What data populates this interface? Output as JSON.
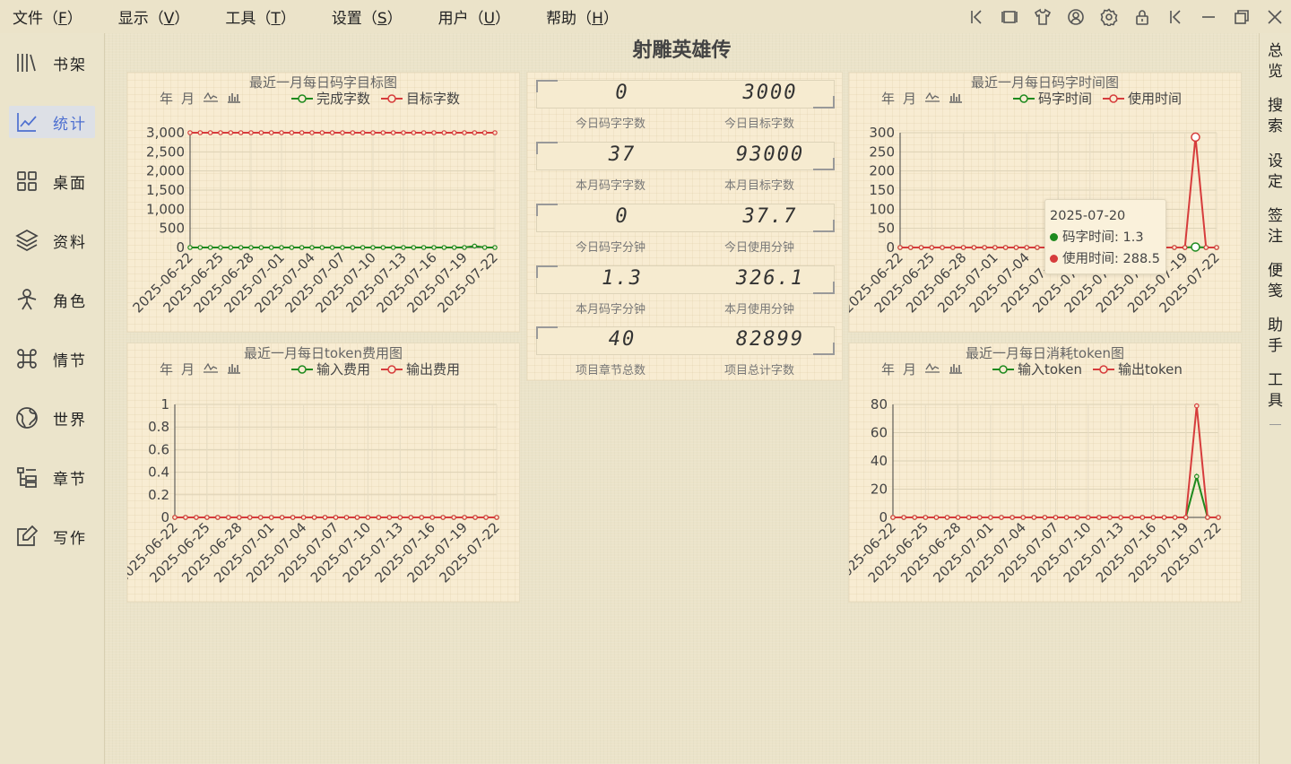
{
  "menu": [
    {
      "label": "文件",
      "key": "F"
    },
    {
      "label": "显示",
      "key": "V"
    },
    {
      "label": "工具",
      "key": "T"
    },
    {
      "label": "设置",
      "key": "S"
    },
    {
      "label": "用户",
      "key": "U"
    },
    {
      "label": "帮助",
      "key": "H"
    }
  ],
  "toolbar_icons": [
    "collapse-left-icon",
    "window-frame-icon",
    "shirt-theme-icon",
    "user-circle-icon",
    "gear-icon",
    "lock-icon",
    "chevron-left-icon",
    "minimize-icon",
    "restore-icon",
    "close-icon"
  ],
  "sidebar": {
    "items": [
      {
        "label": "书架",
        "icon": "bookshelf-icon"
      },
      {
        "label": "统计",
        "icon": "chart-line-icon",
        "active": true
      },
      {
        "label": "桌面",
        "icon": "grid-icon"
      },
      {
        "label": "资料",
        "icon": "layers-icon"
      },
      {
        "label": "角色",
        "icon": "person-icon"
      },
      {
        "label": "情节",
        "icon": "command-icon"
      },
      {
        "label": "世界",
        "icon": "globe-icon"
      },
      {
        "label": "章节",
        "icon": "tree-list-icon"
      },
      {
        "label": "写作",
        "icon": "edit-icon"
      }
    ]
  },
  "rightbar": {
    "items": [
      {
        "top": "总",
        "bottom": "览"
      },
      {
        "top": "搜",
        "bottom": "索"
      },
      {
        "top": "设",
        "bottom": "定"
      },
      {
        "top": "签",
        "bottom": "注"
      },
      {
        "top": "便",
        "bottom": "笺"
      },
      {
        "top": "助",
        "bottom": "手"
      },
      {
        "top": "工",
        "bottom": "具"
      }
    ]
  },
  "project_title": "射雕英雄传",
  "chart_toolbar": {
    "year": "年",
    "month": "月",
    "line": "line-chart-icon",
    "bar": "bar-chart-icon"
  },
  "stats": [
    {
      "left_value": "0",
      "left_label": "今日码字字数",
      "right_value": "3000",
      "right_label": "今日目标字数"
    },
    {
      "left_value": "37",
      "left_label": "本月码字字数",
      "right_value": "93000",
      "right_label": "本月目标字数"
    },
    {
      "left_value": "0",
      "left_label": "今日码字分钟",
      "right_value": "37.7",
      "right_label": "今日使用分钟"
    },
    {
      "left_value": "1.3",
      "left_label": "本月码字分钟",
      "right_value": "326.1",
      "right_label": "本月使用分钟"
    },
    {
      "left_value": "40",
      "left_label": "项目章节总数",
      "right_value": "82899",
      "right_label": "项目总计字数"
    }
  ],
  "tooltip": {
    "date": "2025-07-20",
    "row1": "码字时间: 1.3",
    "row2": "使用时间: 288.5"
  },
  "chart_data": [
    {
      "type": "line",
      "title": "最近一月每日码字目标图",
      "x": [
        "2025-06-22",
        "2025-06-23",
        "2025-06-24",
        "2025-06-25",
        "2025-06-26",
        "2025-06-27",
        "2025-06-28",
        "2025-06-29",
        "2025-06-30",
        "2025-07-01",
        "2025-07-02",
        "2025-07-03",
        "2025-07-04",
        "2025-07-05",
        "2025-07-06",
        "2025-07-07",
        "2025-07-08",
        "2025-07-09",
        "2025-07-10",
        "2025-07-11",
        "2025-07-12",
        "2025-07-13",
        "2025-07-14",
        "2025-07-15",
        "2025-07-16",
        "2025-07-17",
        "2025-07-18",
        "2025-07-19",
        "2025-07-20",
        "2025-07-21",
        "2025-07-22"
      ],
      "xticks": [
        "2025-06-22",
        "2025-06-25",
        "2025-06-28",
        "2025-07-01",
        "2025-07-04",
        "2025-07-07",
        "2025-07-10",
        "2025-07-13",
        "2025-07-16",
        "2025-07-19",
        "2025-07-22"
      ],
      "yticks": [
        "0",
        "500",
        "1,000",
        "1,500",
        "2,000",
        "2,500",
        "3,000"
      ],
      "ylim": [
        0,
        3000
      ],
      "series": [
        {
          "name": "完成字数",
          "color": "#1e8a1e",
          "values": [
            0,
            0,
            0,
            0,
            0,
            0,
            0,
            0,
            0,
            0,
            0,
            0,
            0,
            0,
            0,
            0,
            0,
            0,
            0,
            0,
            0,
            0,
            0,
            0,
            0,
            0,
            0,
            0,
            37,
            0,
            0
          ]
        },
        {
          "name": "目标字数",
          "color": "#d63c3c",
          "values": [
            3000,
            3000,
            3000,
            3000,
            3000,
            3000,
            3000,
            3000,
            3000,
            3000,
            3000,
            3000,
            3000,
            3000,
            3000,
            3000,
            3000,
            3000,
            3000,
            3000,
            3000,
            3000,
            3000,
            3000,
            3000,
            3000,
            3000,
            3000,
            3000,
            3000,
            3000
          ]
        }
      ]
    },
    {
      "type": "line",
      "title": "最近一月每日码字时间图",
      "x": [
        "2025-06-22",
        "2025-06-23",
        "2025-06-24",
        "2025-06-25",
        "2025-06-26",
        "2025-06-27",
        "2025-06-28",
        "2025-06-29",
        "2025-06-30",
        "2025-07-01",
        "2025-07-02",
        "2025-07-03",
        "2025-07-04",
        "2025-07-05",
        "2025-07-06",
        "2025-07-07",
        "2025-07-08",
        "2025-07-09",
        "2025-07-10",
        "2025-07-11",
        "2025-07-12",
        "2025-07-13",
        "2025-07-14",
        "2025-07-15",
        "2025-07-16",
        "2025-07-17",
        "2025-07-18",
        "2025-07-19",
        "2025-07-20",
        "2025-07-21",
        "2025-07-22"
      ],
      "xticks": [
        "2025-06-22",
        "2025-06-25",
        "2025-06-28",
        "2025-07-01",
        "2025-07-04",
        "2025-07-07",
        "2025-07-10",
        "2025-07-13",
        "2025-07-16",
        "2025-07-19",
        "2025-07-22"
      ],
      "yticks": [
        "0",
        "50",
        "100",
        "150",
        "200",
        "250",
        "300"
      ],
      "ylim": [
        0,
        300
      ],
      "series": [
        {
          "name": "码字时间",
          "color": "#1e8a1e",
          "values": [
            0,
            0,
            0,
            0,
            0,
            0,
            0,
            0,
            0,
            0,
            0,
            0,
            0,
            0,
            0,
            0,
            0,
            0,
            0,
            0,
            0,
            0,
            0,
            0,
            0,
            0,
            0,
            0,
            1.3,
            0,
            0
          ]
        },
        {
          "name": "使用时间",
          "color": "#d63c3c",
          "values": [
            0,
            0,
            0,
            0,
            0,
            0,
            0,
            0,
            0,
            0,
            0,
            0,
            0,
            0,
            0,
            0,
            0,
            0,
            0,
            0,
            0,
            0,
            0,
            0,
            0,
            0,
            0,
            0,
            288.5,
            0,
            0
          ]
        }
      ]
    },
    {
      "type": "line",
      "title": "最近一月每日token费用图",
      "x": [
        "2025-06-22",
        "2025-06-23",
        "2025-06-24",
        "2025-06-25",
        "2025-06-26",
        "2025-06-27",
        "2025-06-28",
        "2025-06-29",
        "2025-06-30",
        "2025-07-01",
        "2025-07-02",
        "2025-07-03",
        "2025-07-04",
        "2025-07-05",
        "2025-07-06",
        "2025-07-07",
        "2025-07-08",
        "2025-07-09",
        "2025-07-10",
        "2025-07-11",
        "2025-07-12",
        "2025-07-13",
        "2025-07-14",
        "2025-07-15",
        "2025-07-16",
        "2025-07-17",
        "2025-07-18",
        "2025-07-19",
        "2025-07-20",
        "2025-07-21",
        "2025-07-22"
      ],
      "xticks": [
        "2025-06-22",
        "2025-06-25",
        "2025-06-28",
        "2025-07-01",
        "2025-07-04",
        "2025-07-07",
        "2025-07-10",
        "2025-07-13",
        "2025-07-16",
        "2025-07-19",
        "2025-07-22"
      ],
      "yticks": [
        "0",
        "0.2",
        "0.4",
        "0.6",
        "0.8",
        "1"
      ],
      "ylim": [
        0,
        1
      ],
      "series": [
        {
          "name": "输入费用",
          "color": "#1e8a1e",
          "values": [
            0,
            0,
            0,
            0,
            0,
            0,
            0,
            0,
            0,
            0,
            0,
            0,
            0,
            0,
            0,
            0,
            0,
            0,
            0,
            0,
            0,
            0,
            0,
            0,
            0,
            0,
            0,
            0,
            0,
            0,
            0
          ]
        },
        {
          "name": "输出费用",
          "color": "#d63c3c",
          "values": [
            0,
            0,
            0,
            0,
            0,
            0,
            0,
            0,
            0,
            0,
            0,
            0,
            0,
            0,
            0,
            0,
            0,
            0,
            0,
            0,
            0,
            0,
            0,
            0,
            0,
            0,
            0,
            0,
            0,
            0,
            0
          ]
        }
      ]
    },
    {
      "type": "line",
      "title": "最近一月每日消耗token图",
      "x": [
        "2025-06-22",
        "2025-06-23",
        "2025-06-24",
        "2025-06-25",
        "2025-06-26",
        "2025-06-27",
        "2025-06-28",
        "2025-06-29",
        "2025-06-30",
        "2025-07-01",
        "2025-07-02",
        "2025-07-03",
        "2025-07-04",
        "2025-07-05",
        "2025-07-06",
        "2025-07-07",
        "2025-07-08",
        "2025-07-09",
        "2025-07-10",
        "2025-07-11",
        "2025-07-12",
        "2025-07-13",
        "2025-07-14",
        "2025-07-15",
        "2025-07-16",
        "2025-07-17",
        "2025-07-18",
        "2025-07-19",
        "2025-07-20",
        "2025-07-21",
        "2025-07-22"
      ],
      "xticks": [
        "2025-06-22",
        "2025-06-25",
        "2025-06-28",
        "2025-07-01",
        "2025-07-04",
        "2025-07-07",
        "2025-07-10",
        "2025-07-13",
        "2025-07-16",
        "2025-07-19",
        "2025-07-22"
      ],
      "yticks": [
        "0",
        "20",
        "40",
        "60",
        "80"
      ],
      "ylim": [
        0,
        80
      ],
      "series": [
        {
          "name": "输入token",
          "color": "#1e8a1e",
          "values": [
            0,
            0,
            0,
            0,
            0,
            0,
            0,
            0,
            0,
            0,
            0,
            0,
            0,
            0,
            0,
            0,
            0,
            0,
            0,
            0,
            0,
            0,
            0,
            0,
            0,
            0,
            0,
            0,
            29,
            0,
            0
          ]
        },
        {
          "name": "输出token",
          "color": "#d63c3c",
          "values": [
            0,
            0,
            0,
            0,
            0,
            0,
            0,
            0,
            0,
            0,
            0,
            0,
            0,
            0,
            0,
            0,
            0,
            0,
            0,
            0,
            0,
            0,
            0,
            0,
            0,
            0,
            0,
            0,
            79,
            0,
            0
          ]
        }
      ]
    }
  ]
}
